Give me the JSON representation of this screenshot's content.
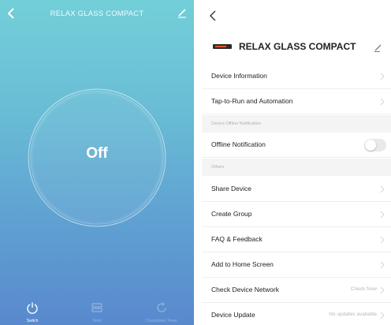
{
  "left": {
    "title": "RELAX GLASS COMPACT",
    "power_state": "Off",
    "tabs": [
      {
        "label": "Switch",
        "icon": "power-icon"
      },
      {
        "label": "Timer",
        "icon": "timer-icon"
      },
      {
        "label": "Countdown Timer",
        "icon": "countdown-icon"
      }
    ]
  },
  "right": {
    "device_name": "RELAX GLASS COMPACT",
    "items": {
      "device_information": "Device Information",
      "tap_to_run": "Tap-to-Run and Automation",
      "offline_section": "Device Offline Notification",
      "offline_notification": "Offline Notification",
      "others_section": "Others",
      "share_device": "Share Device",
      "create_group": "Create Group",
      "faq": "FAQ & Feedback",
      "add_home": "Add to Home Screen",
      "check_network": "Check Device Network",
      "check_network_value": "Check Now",
      "device_update": "Device Update",
      "device_update_value": "No updates available"
    },
    "offline_toggle_on": false
  },
  "colors": {
    "gradient_top": "#72cfd8",
    "gradient_bottom": "#5889cd",
    "section_bg": "#f4f4f4"
  }
}
